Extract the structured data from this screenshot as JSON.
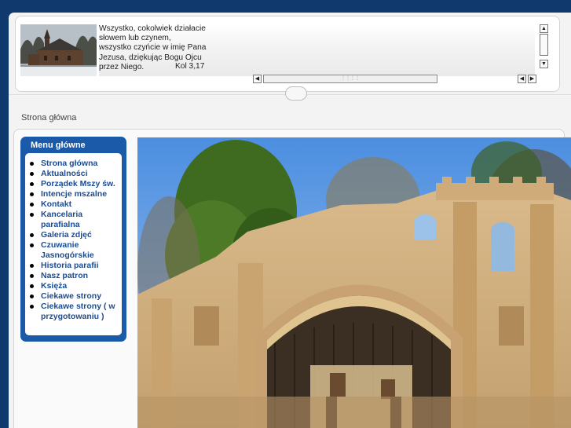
{
  "header": {
    "quote_lines": [
      "Wszystko, cokolwiek działacie",
      "słowem lub czynem,",
      "wszystko czyńcie w imię Pana",
      "Jezusa, dziękując Bogu Ojcu",
      "przez Niego."
    ],
    "quote_reference": "Kol 3,17",
    "thumbnail_icon": "wooden-church-photo"
  },
  "breadcrumb": "Strona główna",
  "menu": {
    "title": "Menu główne",
    "items": [
      {
        "label": "Strona główna"
      },
      {
        "label": "Aktualności"
      },
      {
        "label": "Porządek Mszy św."
      },
      {
        "label": "Intencje mszalne"
      },
      {
        "label": "Kontakt"
      },
      {
        "label": "Kancelaria parafialna"
      },
      {
        "label": "Galeria zdjęć"
      },
      {
        "label": "Czuwanie Jasnogórskie"
      },
      {
        "label": "Historia parafii"
      },
      {
        "label": "Nasz patron"
      },
      {
        "label": "Księża"
      },
      {
        "label": "Ciekawe strony"
      },
      {
        "label": "Ciekawe strony ( w przygotowaniu )"
      }
    ]
  },
  "main_image": "open-air-altar-photo",
  "colors": {
    "background": "#103a6e",
    "menu_box": "#1a5aa8",
    "menu_link": "#1a4c94"
  }
}
